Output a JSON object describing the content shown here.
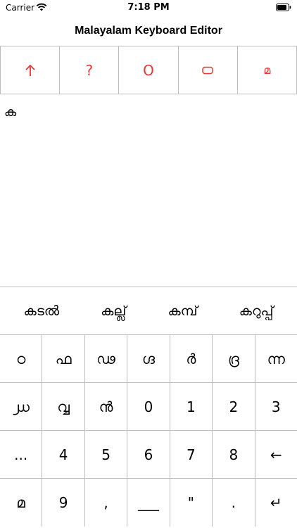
{
  "status_bar": {
    "carrier": "Carrier",
    "time": "7:18 PM",
    "wifi_icon": "wifi-icon",
    "battery_icon": "battery-icon"
  },
  "nav": {
    "title": "Malayalam Keyboard Editor"
  },
  "toolbar": {
    "accent_color": "#e53935",
    "buttons": [
      {
        "name": "up-arrow-icon",
        "label": "↑"
      },
      {
        "name": "question-icon",
        "label": "?"
      },
      {
        "name": "circle-icon",
        "label": "O"
      },
      {
        "name": "rounded-rect-icon",
        "label": ""
      },
      {
        "name": "malayalam-ma-icon",
        "label": "മ"
      }
    ]
  },
  "editor": {
    "text": "ക"
  },
  "keyboard": {
    "suggestions": [
      "കടൽ",
      "കല്ല്",
      "കമ്പ്",
      "കറുപ്പ്"
    ],
    "rows": [
      [
        "ഠ",
        "ഫ",
        "ഢ",
        "ഗ്ദ",
        "ർ",
        "ദ്ര",
        "ന്ന"
      ],
      [
        "൰",
        "വ്വ",
        "ൻ",
        "0",
        "1",
        "2",
        "3"
      ],
      [
        "...",
        "4",
        "5",
        "6",
        "7",
        "8",
        "←"
      ],
      [
        "മ",
        "9",
        ",",
        "___",
        "\"",
        ".",
        "↵"
      ]
    ]
  }
}
